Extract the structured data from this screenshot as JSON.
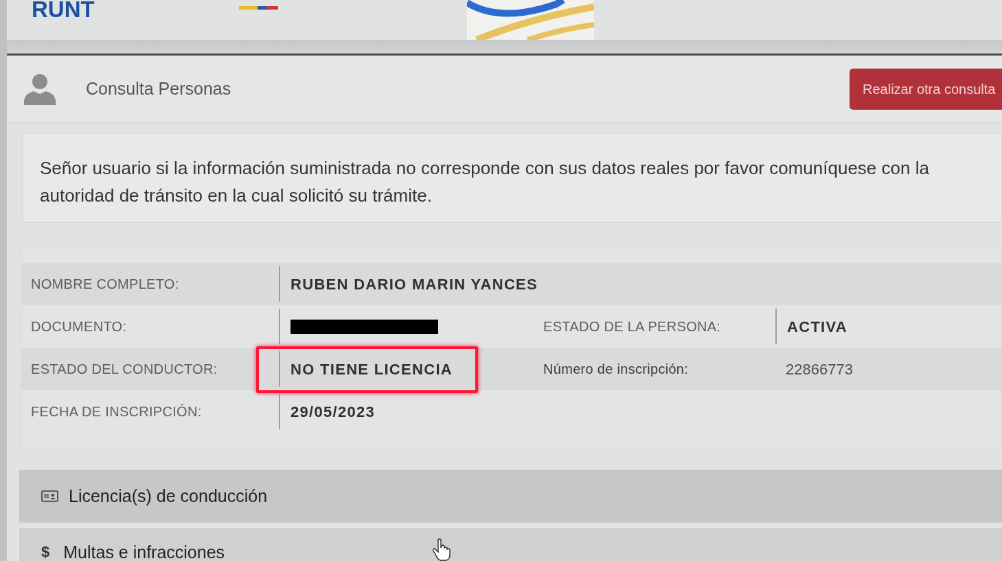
{
  "header": {
    "logo": "RUNT"
  },
  "section_bar": {
    "title": "Consulta Personas",
    "button": "Realizar otra consulta"
  },
  "notice": "Señor usuario si la información suministrada no corresponde con sus datos reales por favor comuníquese con la autoridad de tránsito en la cual solicitó su trámite.",
  "details": {
    "rows": [
      {
        "pairs": [
          {
            "label": "NOMBRE COMPLETO:",
            "value": "RUBEN DARIO MARIN YANCES",
            "kind": "bold",
            "highlighted": false
          }
        ]
      },
      {
        "pairs": [
          {
            "label": "DOCUMENTO:",
            "kind": "redacted",
            "highlighted": false
          },
          {
            "label": "ESTADO DE LA PERSONA:",
            "value": "ACTIVA",
            "kind": "bold",
            "highlighted": false
          }
        ]
      },
      {
        "pairs": [
          {
            "label": "ESTADO DEL CONDUCTOR:",
            "value": "NO TIENE LICENCIA",
            "kind": "bold",
            "highlighted": true
          },
          {
            "label": "Número de inscripción:",
            "value": "22866773",
            "kind": "plain",
            "highlighted": false
          }
        ]
      },
      {
        "pairs": [
          {
            "label": "FECHA DE INSCRIPCIÓN:",
            "value": "29/05/2023",
            "kind": "bold",
            "highlighted": false
          }
        ]
      }
    ]
  },
  "panels": [
    {
      "title": "Licencia(s) de conducción",
      "kind": "card"
    },
    {
      "title": "Multas e infracciones",
      "kind": "glyph",
      "glyph": "$"
    }
  ]
}
